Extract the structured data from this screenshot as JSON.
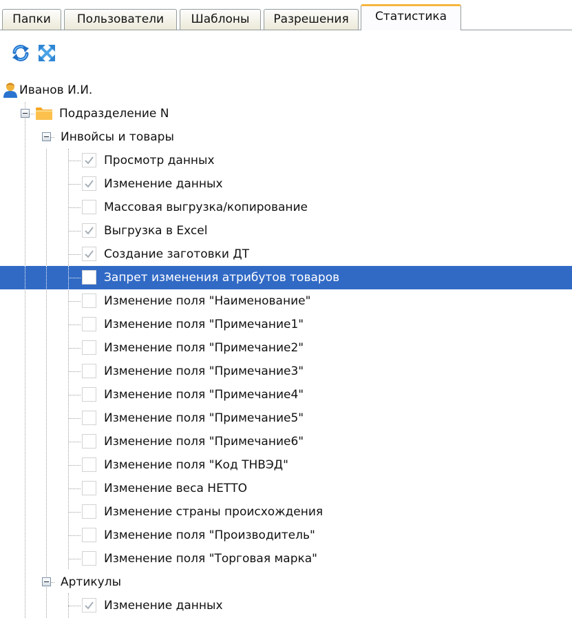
{
  "tabs": [
    {
      "label": "Папки",
      "active": false
    },
    {
      "label": "Пользователи",
      "active": false
    },
    {
      "label": "Шаблоны",
      "active": false
    },
    {
      "label": "Разрешения",
      "active": false
    },
    {
      "label": "Статистика",
      "active": true
    }
  ],
  "toolbar": {
    "refresh_icon": "refresh-icon",
    "expand_icon": "expand-icon"
  },
  "tree": {
    "user": {
      "label": "Иванов И.И.",
      "icon": "user-icon"
    },
    "department": {
      "label": "Подразделение N",
      "icon": "folder-icon",
      "expanded": true
    },
    "groups": [
      {
        "label": "Инвойсы и товары",
        "expanded": true,
        "items": [
          {
            "label": "Просмотр данных",
            "checked": true,
            "selected": false
          },
          {
            "label": "Изменение данных",
            "checked": true,
            "selected": false
          },
          {
            "label": "Массовая выгрузка/копирование",
            "checked": false,
            "selected": false
          },
          {
            "label": "Выгрузка в Excel",
            "checked": true,
            "selected": false
          },
          {
            "label": "Создание заготовки ДТ",
            "checked": true,
            "selected": false
          },
          {
            "label": "Запрет изменения атрибутов товаров",
            "checked": false,
            "selected": true
          },
          {
            "label": "Изменение поля \"Наименование\"",
            "checked": false,
            "selected": false
          },
          {
            "label": "Изменение поля \"Примечание1\"",
            "checked": false,
            "selected": false
          },
          {
            "label": "Изменение поля \"Примечание2\"",
            "checked": false,
            "selected": false
          },
          {
            "label": "Изменение поля \"Примечание3\"",
            "checked": false,
            "selected": false
          },
          {
            "label": "Изменение поля \"Примечание4\"",
            "checked": false,
            "selected": false
          },
          {
            "label": "Изменение поля \"Примечание5\"",
            "checked": false,
            "selected": false
          },
          {
            "label": "Изменение поля \"Примечание6\"",
            "checked": false,
            "selected": false
          },
          {
            "label": "Изменение поля \"Код ТНВЭД\"",
            "checked": false,
            "selected": false
          },
          {
            "label": "Изменение веса НЕТТО",
            "checked": false,
            "selected": false
          },
          {
            "label": "Изменение страны происхождения",
            "checked": false,
            "selected": false
          },
          {
            "label": "Изменение поля \"Производитель\"",
            "checked": false,
            "selected": false
          },
          {
            "label": "Изменение поля \"Торговая марка\"",
            "checked": false,
            "selected": false
          }
        ]
      },
      {
        "label": "Артикулы",
        "expanded": true,
        "items": [
          {
            "label": "Изменение данных",
            "checked": true,
            "selected": false
          }
        ]
      }
    ]
  },
  "colors": {
    "selection": "#316ac5",
    "active_tab_accent": "#f6b53d",
    "check_mark": "#a6aeb6"
  }
}
